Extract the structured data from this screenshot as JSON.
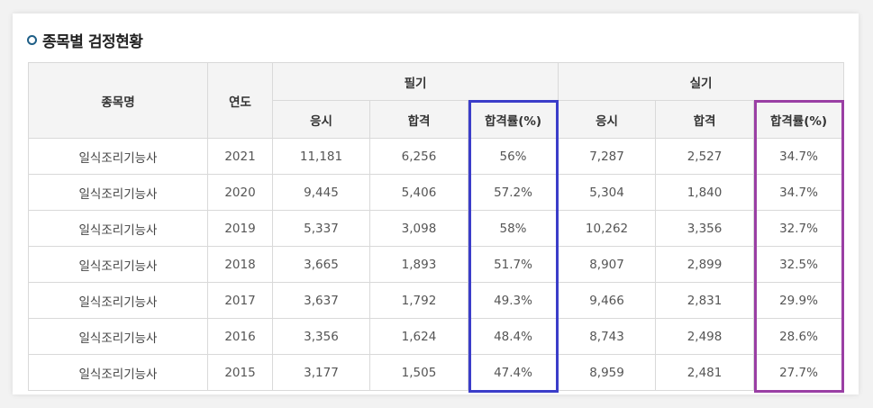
{
  "section": {
    "title": "종목별 검정현황"
  },
  "table": {
    "headers": {
      "name": "종목명",
      "year": "연도",
      "written": "필기",
      "practical": "실기",
      "applicants": "응시",
      "passed": "합격",
      "pass_rate": "합격률(%)"
    },
    "rows": [
      {
        "name": "일식조리기능사",
        "year": "2021",
        "w_app": "11,181",
        "w_pass": "6,256",
        "w_rate": "56%",
        "p_app": "7,287",
        "p_pass": "2,527",
        "p_rate": "34.7%"
      },
      {
        "name": "일식조리기능사",
        "year": "2020",
        "w_app": "9,445",
        "w_pass": "5,406",
        "w_rate": "57.2%",
        "p_app": "5,304",
        "p_pass": "1,840",
        "p_rate": "34.7%"
      },
      {
        "name": "일식조리기능사",
        "year": "2019",
        "w_app": "5,337",
        "w_pass": "3,098",
        "w_rate": "58%",
        "p_app": "10,262",
        "p_pass": "3,356",
        "p_rate": "32.7%"
      },
      {
        "name": "일식조리기능사",
        "year": "2018",
        "w_app": "3,665",
        "w_pass": "1,893",
        "w_rate": "51.7%",
        "p_app": "8,907",
        "p_pass": "2,899",
        "p_rate": "32.5%"
      },
      {
        "name": "일식조리기능사",
        "year": "2017",
        "w_app": "3,637",
        "w_pass": "1,792",
        "w_rate": "49.3%",
        "p_app": "9,466",
        "p_pass": "2,831",
        "p_rate": "29.9%"
      },
      {
        "name": "일식조리기능사",
        "year": "2016",
        "w_app": "3,356",
        "w_pass": "1,624",
        "w_rate": "48.4%",
        "p_app": "8,743",
        "p_pass": "2,498",
        "p_rate": "28.6%"
      },
      {
        "name": "일식조리기능사",
        "year": "2015",
        "w_app": "3,177",
        "w_pass": "1,505",
        "w_rate": "47.4%",
        "p_app": "8,959",
        "p_pass": "2,481",
        "p_rate": "27.7%"
      }
    ]
  },
  "highlights": {
    "written_rate_color": "#3b3dc9",
    "practical_rate_color": "#9a3fa4"
  }
}
